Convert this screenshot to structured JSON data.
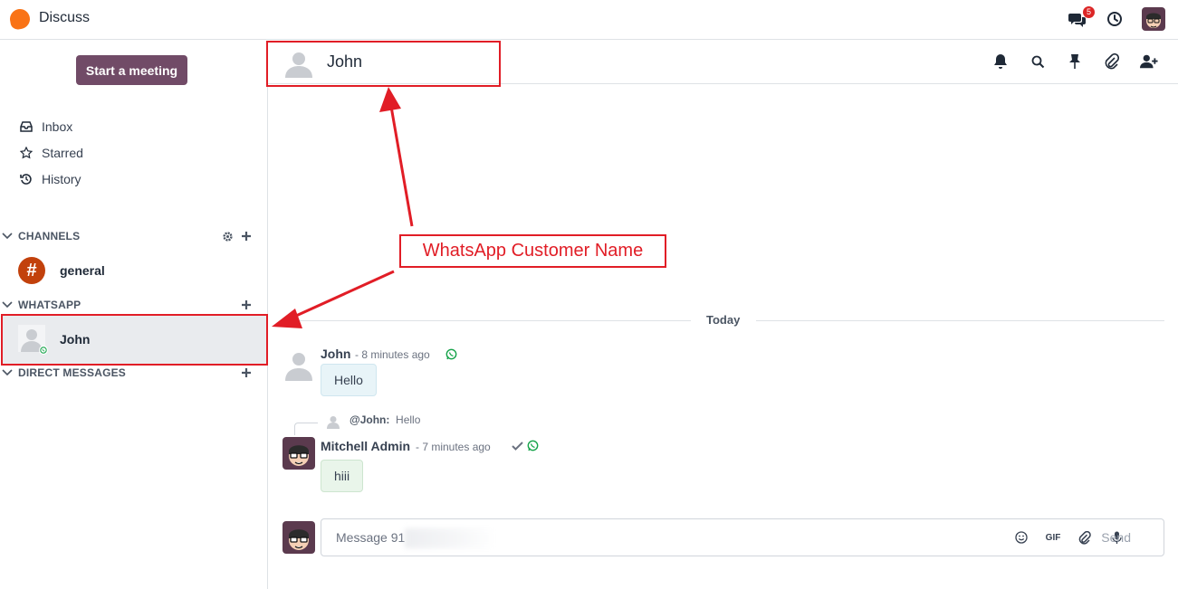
{
  "app": {
    "title": "Discuss",
    "brand_color": "#f97316",
    "accent": "#714b67"
  },
  "topbar": {
    "messages_icon": "chat-icon",
    "messages_badge": "5",
    "activity_icon": "clock-icon",
    "user_avatar": "user-avatar"
  },
  "sidebar": {
    "start_meeting": "Start a meeting",
    "nav": [
      {
        "label": "Inbox",
        "icon": "inbox-icon"
      },
      {
        "label": "Starred",
        "icon": "star-icon"
      },
      {
        "label": "History",
        "icon": "history-icon"
      }
    ],
    "channels": {
      "label": "CHANNELS",
      "items": [
        {
          "label": "general",
          "icon": "#"
        }
      ]
    },
    "whatsapp": {
      "label": "WHATSAPP",
      "items": [
        {
          "label": "John"
        }
      ]
    },
    "direct_messages": {
      "label": "DIRECT MESSAGES"
    }
  },
  "thread": {
    "name": "John",
    "actions": [
      "bell-icon",
      "search-icon",
      "pin-icon",
      "paperclip-icon",
      "add-user-icon"
    ]
  },
  "messages": {
    "day_separator": "Today",
    "items": [
      {
        "author": "John",
        "time": "- 8 minutes ago",
        "text": "Hello",
        "channel_icon": "whatsapp-icon"
      },
      {
        "author": "Mitchell Admin",
        "time": "- 7 minutes ago",
        "text": "hiii",
        "reply_to_author": "@John:",
        "reply_to_text": "Hello",
        "status_icon": "check-icon"
      }
    ]
  },
  "composer": {
    "placeholder": "Message 91",
    "tools": [
      "emoji-icon",
      "GIF",
      "paperclip-icon",
      "microphone-icon"
    ],
    "gif_label": "GIF",
    "send_label": "Send"
  },
  "annotation": {
    "label": "WhatsApp Customer Name",
    "color": "#e11d26"
  }
}
